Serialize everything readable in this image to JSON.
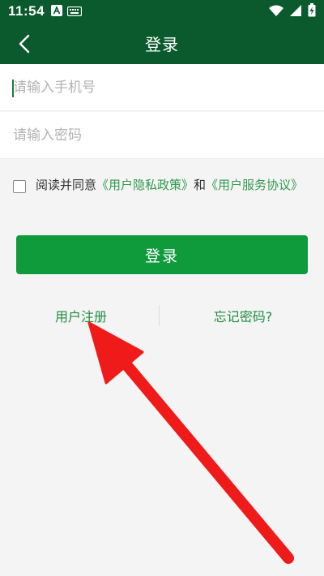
{
  "status_bar": {
    "time": "11:54",
    "icons": [
      "a-icon",
      "keyboard-icon",
      "wifi-icon",
      "signal-icon",
      "battery-charging-icon"
    ]
  },
  "app_bar": {
    "title": "登录",
    "back_icon": "chevron-left-icon"
  },
  "form": {
    "phone_placeholder": "请输入手机号",
    "phone_value": "",
    "password_placeholder": "请输入密码",
    "password_value": ""
  },
  "agreement": {
    "checked": false,
    "prefix": "阅读并同意",
    "privacy_link": "《用户隐私政策》",
    "and": "和",
    "service_link": "《用户服务协议》"
  },
  "login_button": "登录",
  "links": {
    "register": "用户注册",
    "forgot": "忘记密码?"
  },
  "colors": {
    "header": "#0b5a2e",
    "primary_button": "#0f9a3c",
    "link": "#1d8f42",
    "annotation_arrow": "#ef1b1b"
  }
}
